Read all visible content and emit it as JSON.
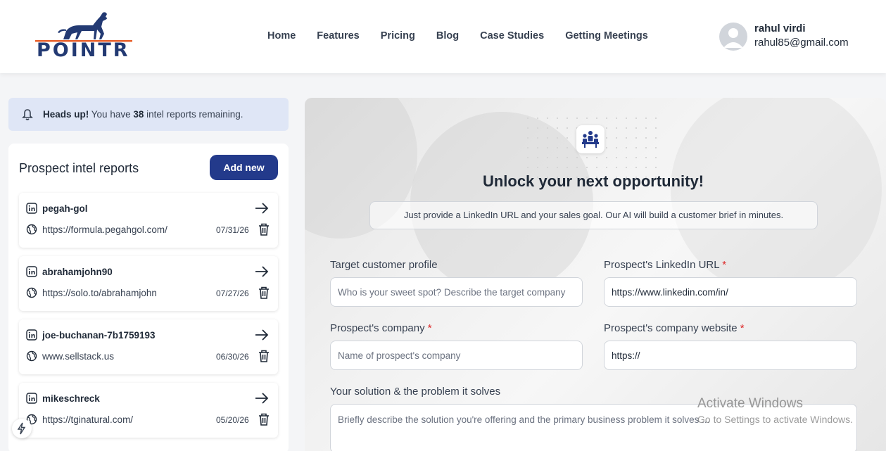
{
  "brand": {
    "name": "POINTR",
    "color": "#233a73",
    "accent": "#e8602c"
  },
  "nav": [
    "Home",
    "Features",
    "Pricing",
    "Blog",
    "Case Studies",
    "Getting Meetings"
  ],
  "user": {
    "name": "rahul virdi",
    "email": "rahul85@gmail.com"
  },
  "alert": {
    "strong": "Heads up!",
    "prefix": "You have",
    "count": "38",
    "suffix": "intel reports remaining."
  },
  "reports_panel": {
    "title": "Prospect intel reports",
    "add_label": "Add new",
    "items": [
      {
        "name": "pegah-gol",
        "url": "https://formula.pegahgol.com/",
        "date": "07/31/26"
      },
      {
        "name": "abrahamjohn90",
        "url": "https://solo.to/abrahamjohn",
        "date": "07/27/26"
      },
      {
        "name": "joe-buchanan-7b1759193",
        "url": "www.sellstack.us",
        "date": "06/30/26"
      },
      {
        "name": "mikeschreck",
        "url": "https://tginatural.com/",
        "date": "05/20/26"
      }
    ]
  },
  "form": {
    "title": "Unlock your next opportunity!",
    "subtitle": "Just provide a LinkedIn URL and your sales goal. Our AI will build a customer brief in minutes.",
    "target_profile": {
      "label": "Target customer profile",
      "placeholder": "Who is your sweet spot? Describe the target company",
      "value": ""
    },
    "linkedin_url": {
      "label": "Prospect's LinkedIn URL",
      "required": "*",
      "value": "https://www.linkedin.com/in/"
    },
    "company": {
      "label": "Prospect's company",
      "required": "*",
      "placeholder": "Name of prospect's company",
      "value": ""
    },
    "website": {
      "label": "Prospect's company website",
      "required": "*",
      "value": "https://"
    },
    "solution": {
      "label": "Your solution & the problem it solves",
      "placeholder": "Briefly describe the solution you're offering and the primary business problem it solves ...",
      "value": ""
    }
  },
  "watermark": {
    "title": "Activate Windows",
    "subtitle": "Go to Settings to activate Windows."
  }
}
